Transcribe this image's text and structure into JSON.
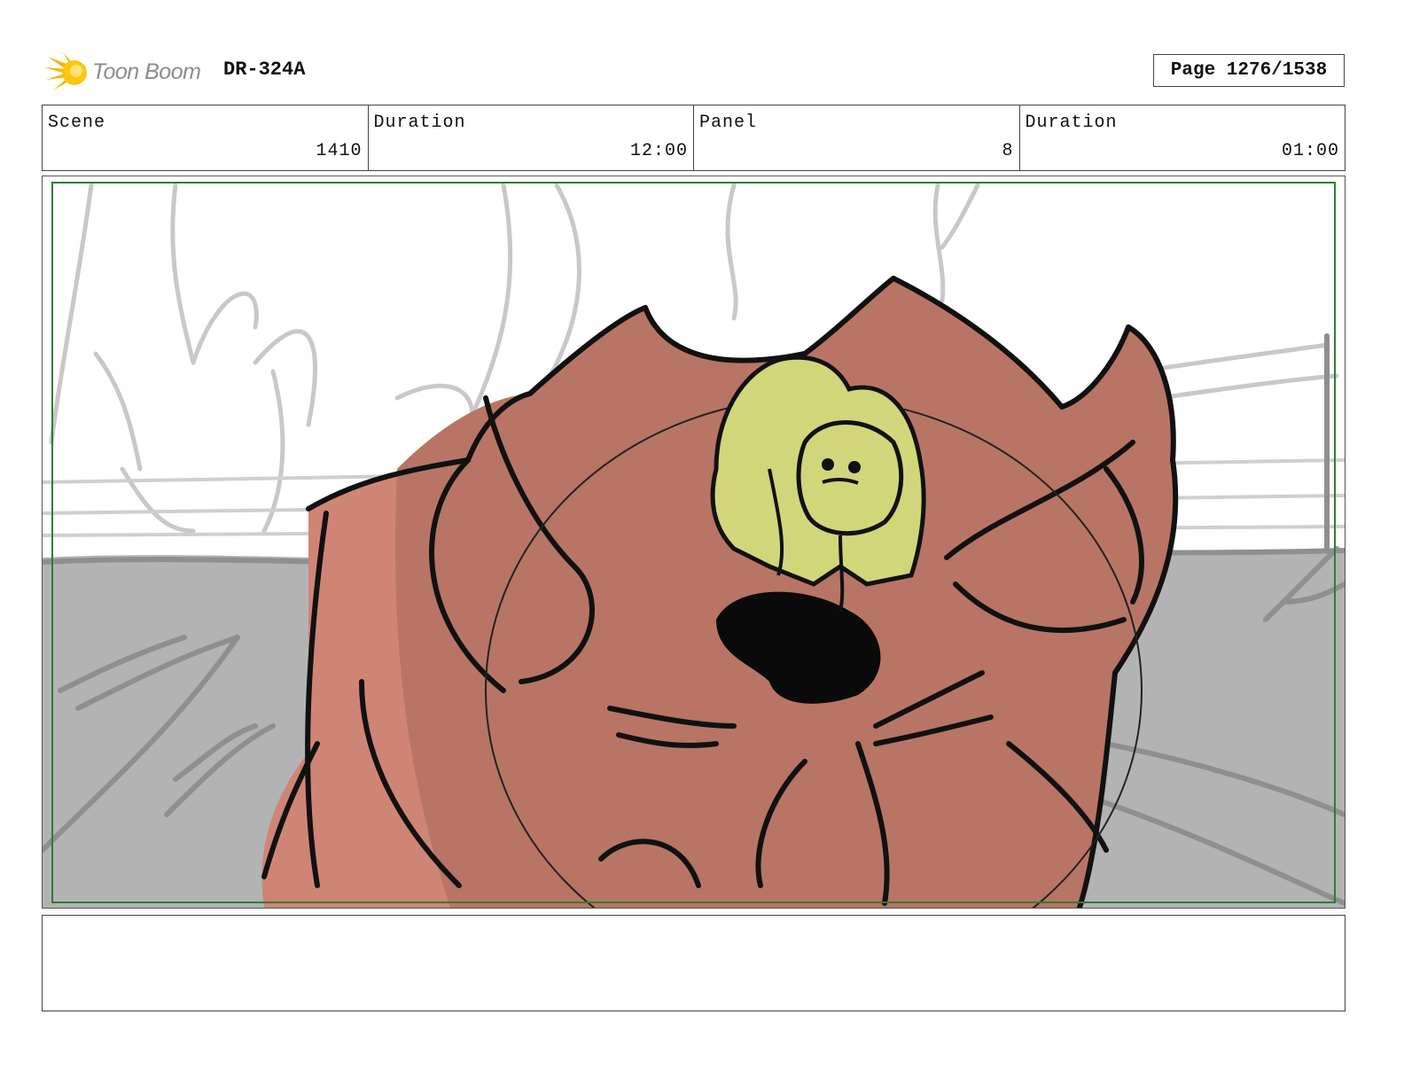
{
  "header": {
    "logo_text": "Toon Boom",
    "logo_icon": "starburst-logo-icon",
    "document_code": "DR-324A",
    "page_label": "Page 1276/1538"
  },
  "info": {
    "scene_label": "Scene",
    "scene_value": "1410",
    "scene_duration_label": "Duration",
    "scene_duration_value": "12:00",
    "panel_label": "Panel",
    "panel_value": "8",
    "panel_duration_label": "Duration",
    "panel_duration_value": "01:00"
  },
  "panel": {
    "safe_frame_color": "#2e7d32",
    "creature_color": "#b87565",
    "creature_side_color": "#cf8575",
    "character_color": "#d2d67a",
    "floor_color": "#b3b3b3"
  },
  "notes": {
    "text": ""
  }
}
